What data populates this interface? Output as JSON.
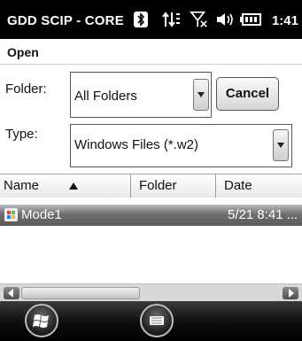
{
  "status_bar": {
    "title": "GDD SCIP - CORE",
    "time": "1:41",
    "icons": [
      "bluetooth-icon",
      "data-sync-icon",
      "signal-off-icon",
      "volume-icon",
      "battery-icon"
    ]
  },
  "header": {
    "title": "Open"
  },
  "form": {
    "folder_label": "Folder:",
    "folder_value": "All Folders",
    "type_label": "Type:",
    "type_value": "Windows Files (*.w2)",
    "cancel_label": "Cancel"
  },
  "list": {
    "columns": [
      "Name",
      "Folder",
      "Date"
    ],
    "sort_indicator": "ascending",
    "rows": [
      {
        "name": "Mode1",
        "folder": "",
        "date": "5/21 8:41 ..."
      }
    ]
  },
  "taskbar": {
    "start_icon": "windows-start-icon",
    "keyboard_icon": "keyboard-icon"
  },
  "colors": {
    "status_bar_bg": "#000000",
    "selected_row": "#6f6f6f"
  }
}
